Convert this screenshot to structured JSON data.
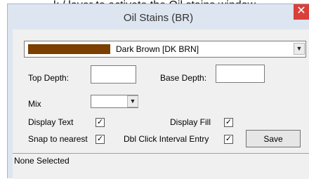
{
  "caption": "k / layer to activate the Oil stains window",
  "window": {
    "title": "Oil Stains (BR)",
    "close_glyph": "✕"
  },
  "color_select": {
    "swatch_color": "#7b3f00",
    "value": "Dark Brown [DK BRN]",
    "dropdown_icon": "chevron-down-icon",
    "arrow_glyph": "▼"
  },
  "fields": {
    "top_depth_label": "Top Depth:",
    "top_depth_value": "",
    "base_depth_label": "Base Depth:",
    "base_depth_value": "",
    "mix_label": "Mix",
    "mix_value": ""
  },
  "checkboxes": {
    "display_text": {
      "label": "Display Text",
      "checked": true
    },
    "display_fill": {
      "label": "Display Fill",
      "checked": true
    },
    "snap_to_nearest": {
      "label": "Snap to nearest",
      "checked": true
    },
    "dbl_click_interval_entry": {
      "label": "Dbl Click Interval Entry",
      "checked": true
    },
    "check_glyph": "✓"
  },
  "buttons": {
    "save_label": "Save"
  },
  "status": {
    "text": "None Selected"
  }
}
